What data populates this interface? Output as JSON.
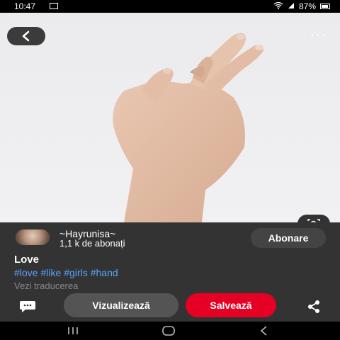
{
  "status_bar": {
    "time": "10:47",
    "battery": "87%"
  },
  "pin": {
    "image_subject": "hand with crossed fingers"
  },
  "author": {
    "name": "~Hayrunisa~",
    "subscribers": "1,1 k de abonați"
  },
  "follow_label": "Abonare",
  "pin_title": "Love",
  "hashtags": [
    "#love",
    "#like",
    "#girls",
    "#hand"
  ],
  "translate_label": "Vezi traducerea",
  "actions": {
    "view_label": "Vizualizează",
    "save_label": "Salvează"
  },
  "colors": {
    "save_red": "#e60023",
    "hashtag_blue": "#5aa3ff",
    "panel_bg": "#333333"
  }
}
